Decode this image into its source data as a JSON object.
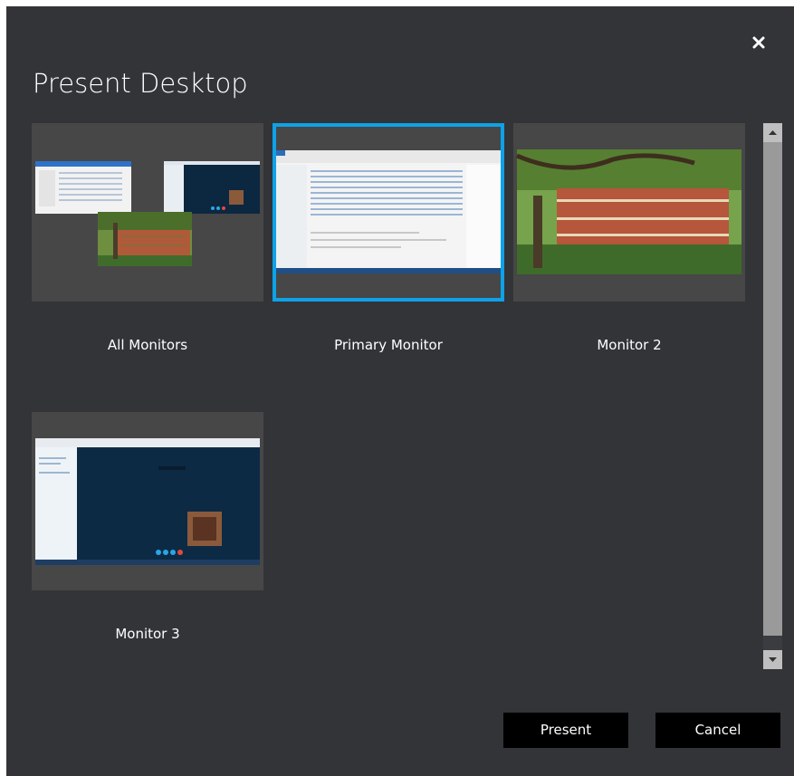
{
  "dialog": {
    "title": "Present Desktop"
  },
  "tiles": [
    {
      "label": "All Monitors"
    },
    {
      "label": "Primary Monitor"
    },
    {
      "label": "Monitor 2"
    },
    {
      "label": "Monitor 3"
    }
  ],
  "buttons": {
    "present": "Present",
    "cancel": "Cancel"
  },
  "icons": {
    "close": "close-icon",
    "scroll_up": "chevron-up-icon",
    "scroll_down": "chevron-down-icon"
  },
  "colors": {
    "background": "#333438",
    "tile": "#474747",
    "selected_border": "#0ea2e8",
    "button": "#000000"
  }
}
